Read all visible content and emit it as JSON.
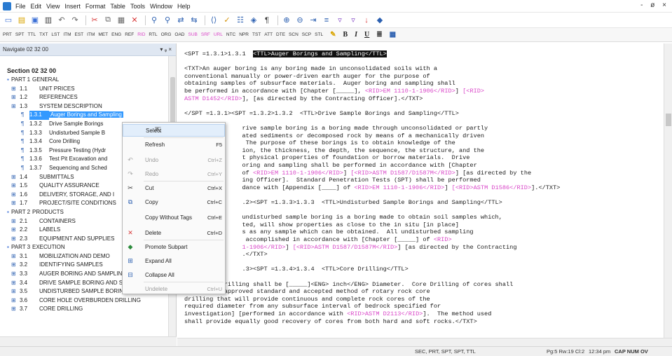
{
  "menu": [
    "File",
    "Edit",
    "View",
    "Insert",
    "Format",
    "Table",
    "Tools",
    "Window",
    "Help"
  ],
  "window_controls": "- ø ×",
  "toolbar": {
    "icons": [
      "new-document-icon",
      "open-folder-icon",
      "save-icon",
      "print-icon",
      "undo-icon",
      "redo-icon",
      "cut-icon",
      "copy-icon",
      "paste-icon",
      "delete-icon",
      "find-icon",
      "find-next-icon",
      "replace-icon",
      "replace-all-icon",
      "show-tags-icon",
      "spellcheck-icon",
      "thesaurus-icon",
      "show-hide-icon",
      "paragraph-icon",
      "zoom-in-icon",
      "zoom-out-icon",
      "indent-icon",
      "list-icon",
      "filter-icon",
      "filter-off-icon",
      "arrow-icon",
      "bookmark-icon"
    ]
  },
  "tag_toolbar": {
    "tags": [
      {
        "t": "PRT",
        "c": "n"
      },
      {
        "t": "SPT",
        "c": "n"
      },
      {
        "t": "TTL",
        "c": "n"
      },
      {
        "t": "TXT",
        "c": "n"
      },
      {
        "t": "LST",
        "c": "n"
      },
      {
        "t": "ITM",
        "c": "n"
      },
      {
        "t": "EST",
        "c": "n"
      },
      {
        "t": "ITM",
        "c": "n"
      },
      {
        "t": "MET",
        "c": "n"
      },
      {
        "t": "ENG",
        "c": "n"
      },
      {
        "t": "REF",
        "c": "n"
      },
      {
        "t": "RID",
        "c": "p"
      },
      {
        "t": "RTL",
        "c": "n"
      },
      {
        "t": "ORG",
        "c": "n"
      },
      {
        "t": "OAD",
        "c": "n"
      },
      {
        "t": "SUB",
        "c": "p"
      },
      {
        "t": "SRF",
        "c": "p"
      },
      {
        "t": "URL",
        "c": "p"
      },
      {
        "t": "NTC",
        "c": "n"
      },
      {
        "t": "NPR",
        "c": "n"
      },
      {
        "t": "TST",
        "c": "n"
      },
      {
        "t": "ATT",
        "c": "n"
      },
      {
        "t": "DTE",
        "c": "n"
      },
      {
        "t": "SCN",
        "c": "n"
      },
      {
        "t": "SCP",
        "c": "n"
      },
      {
        "t": "STL",
        "c": "n"
      }
    ],
    "format": [
      "B",
      "I",
      "U"
    ]
  },
  "navigator": {
    "title": "Navigate 02 32 00",
    "controls": "▾ ᵩ ×",
    "section": "Section 02 32 00",
    "items": [
      {
        "num": "PART 1",
        "label": "GENERAL",
        "indent": 0,
        "icon": "part"
      },
      {
        "num": "1.1",
        "label": "UNIT PRICES",
        "indent": 1
      },
      {
        "num": "1.2",
        "label": "REFERENCES",
        "indent": 1
      },
      {
        "num": "1.3",
        "label": "SYSTEM DESCRIPTION",
        "indent": 1
      },
      {
        "num": "1.3.1",
        "label": "Auger Borings and Sampling",
        "indent": 2,
        "selected": true
      },
      {
        "num": "1.3.2",
        "label": "Drive Sample Borings",
        "indent": 2
      },
      {
        "num": "1.3.3",
        "label": "Undisturbed Sample B",
        "indent": 2
      },
      {
        "num": "1.3.4",
        "label": "Core Drilling",
        "indent": 2
      },
      {
        "num": "1.3.5",
        "label": "Pressure Testing (Hydr",
        "indent": 2
      },
      {
        "num": "1.3.6",
        "label": "Test Pit Excavation and",
        "indent": 2
      },
      {
        "num": "1.3.7",
        "label": "Sequencing and Sched",
        "indent": 2
      },
      {
        "num": "1.4",
        "label": "SUBMITTALS",
        "indent": 1
      },
      {
        "num": "1.5",
        "label": "QUALITY ASSURANCE",
        "indent": 1
      },
      {
        "num": "1.6",
        "label": "DELIVERY, STORAGE, AND I",
        "indent": 1
      },
      {
        "num": "1.7",
        "label": "PROJECT/SITE CONDITIONS",
        "indent": 1
      },
      {
        "num": "PART 2",
        "label": "PRODUCTS",
        "indent": 0,
        "icon": "part"
      },
      {
        "num": "2.1",
        "label": "CONTAINERS",
        "indent": 1
      },
      {
        "num": "2.2",
        "label": "LABELS",
        "indent": 1
      },
      {
        "num": "2.3",
        "label": "EQUIPMENT AND SUPPLIES",
        "indent": 1
      },
      {
        "num": "PART 3",
        "label": "EXECUTION",
        "indent": 0,
        "icon": "part"
      },
      {
        "num": "3.1",
        "label": "MOBILIZATION AND DEMO",
        "indent": 1
      },
      {
        "num": "3.2",
        "label": "IDENTIFYING SAMPLES",
        "indent": 1
      },
      {
        "num": "3.3",
        "label": "AUGER BORING AND SAMPLING",
        "indent": 1
      },
      {
        "num": "3.4",
        "label": "DRIVE SAMPLE BORING AND SAMPLING",
        "indent": 1
      },
      {
        "num": "3.5",
        "label": "UNDISTURBED SAMPLE BORING AND SAMI",
        "indent": 1
      },
      {
        "num": "3.6",
        "label": "CORE HOLE OVERBURDEN DRILLING",
        "indent": 1
      },
      {
        "num": "3.7",
        "label": "CORE DRILLING",
        "indent": 1
      }
    ]
  },
  "editor": {
    "lines": [
      [
        {
          "t": "<SPT =1.3.1>1.3.1  "
        },
        {
          "t": "<TTL>Auger Borings and Sampling</TTL>",
          "h": 1
        }
      ],
      [
        {
          "t": ""
        }
      ],
      [
        {
          "t": "<TXT>An auger boring is any boring made in unconsolidated soils with a"
        }
      ],
      [
        {
          "t": "conventional manually or power-driven earth auger for the purpose of"
        }
      ],
      [
        {
          "t": "obtaining samples of subsurface materials.  Auger boring and sampling shall"
        }
      ],
      [
        {
          "t": "be performed in accordance with [Chapter [_____], "
        },
        {
          "t": "<RID>EM 1110-1-1906</RID>",
          "p": 1
        },
        {
          "t": "] "
        },
        {
          "t": "[<RID>",
          "p": 1
        }
      ],
      [
        {
          "t": "ASTM D1452</RID>",
          "p": 1
        },
        {
          "t": "], [as directed by the Contracting Officer].</TXT>"
        }
      ],
      [
        {
          "t": ""
        }
      ],
      [
        {
          "t": "</SPT =1.3.1><SPT =1.3.2>1.3.2  <TTL>Drive Sample Borings and Sampling</TTL>"
        }
      ],
      [
        {
          "t": ""
        }
      ],
      [
        {
          "t": "                rive sample boring is a boring made through unconsolidated or partly"
        }
      ],
      [
        {
          "t": "                ated sediments or decomposed rock by means of a mechanically driven"
        }
      ],
      [
        {
          "t": "                 The purpose of these borings is to obtain knowledge of the"
        }
      ],
      [
        {
          "t": "                ion, the thickness, the depth, the sequence, the structure, and the"
        }
      ],
      [
        {
          "t": "                t physical properties of foundation or borrow materials.  Drive"
        }
      ],
      [
        {
          "t": "                oring and sampling shall be performed in accordance with [Chapter"
        }
      ],
      [
        {
          "t": "                of "
        },
        {
          "t": "<RID>EM 1110-1-1906</RID>",
          "p": 1
        },
        {
          "t": "] "
        },
        {
          "t": "[<RID>ASTM D1587/D1587M</RID>",
          "p": 1
        },
        {
          "t": "] [as directed by the"
        }
      ],
      [
        {
          "t": "                ing Officer].  Standard Penetration Tests (SPT) shall be performed"
        }
      ],
      [
        {
          "t": "                dance with [Appendix [____] of "
        },
        {
          "t": "<RID>EM 1110-1-1906</RID>",
          "p": 1
        },
        {
          "t": "] "
        },
        {
          "t": "[<RID>ASTM D1586</RID>",
          "p": 1
        },
        {
          "t": "].</TXT>"
        }
      ],
      [
        {
          "t": ""
        }
      ],
      [
        {
          "t": "                .2><SPT =1.3.3>1.3.3  <TTL>Undisturbed Sample Borings and Sampling</TTL>"
        }
      ],
      [
        {
          "t": ""
        }
      ],
      [
        {
          "t": "                undisturbed sample boring is a boring made to obtain soil samples which,"
        }
      ],
      [
        {
          "t": "                ted, will show properties as close to the in situ [in place]"
        }
      ],
      [
        {
          "t": "                s as any sample which can be obtained.  All undisturbed sampling"
        }
      ],
      [
        {
          "t": "                 accomplished in accordance with [Chapter [_____] of "
        },
        {
          "t": "<RID>",
          "p": 1
        }
      ],
      [
        {
          "t": "                1-1906</RID>",
          "p": 1
        },
        {
          "t": "] "
        },
        {
          "t": "[<RID>ASTM D1587/D1587M</RID>",
          "p": 1
        },
        {
          "t": "] [as directed by the Contracting"
        }
      ],
      [
        {
          "t": "                .</TXT>"
        }
      ],
      [
        {
          "t": ""
        }
      ],
      [
        {
          "t": "                .3><SPT =1.3.4>1.3.4  <TTL>Core Drilling</TTL>"
        }
      ],
      [
        {
          "t": ""
        }
      ],
      [
        {
          "t": "<TXT>Core drilling shall be [_____]<ENG> inch</ENG> Diameter.  Core Drilling of cores shall"
        }
      ],
      [
        {
          "t": "be [by any approved standard and accepted method of rotary rock core"
        }
      ],
      [
        {
          "t": "drilling that will provide continuous and complete rock cores of the"
        }
      ],
      [
        {
          "t": "required diameter from any subsurface interval of bedrock specified for"
        }
      ],
      [
        {
          "t": "investigation] [performed in accordance with "
        },
        {
          "t": "<RID>ASTM D2113</RID>",
          "p": 1
        },
        {
          "t": "].  The method used"
        }
      ],
      [
        {
          "t": "shall provide equally good recovery of cores from both hard and soft rocks.</TXT>"
        }
      ]
    ]
  },
  "context_menu": {
    "items": [
      {
        "label": "Select",
        "shortcut": "",
        "icon": "",
        "hover": true
      },
      {
        "label": "Refresh",
        "shortcut": "F5",
        "icon": ""
      },
      {
        "label": "Undo",
        "shortcut": "Ctrl+Z",
        "icon": "undo-icon",
        "disabled": true
      },
      {
        "label": "Redo",
        "shortcut": "Ctrl+Y",
        "icon": "redo-icon",
        "disabled": true
      },
      {
        "label": "Cut",
        "shortcut": "Ctrl+X",
        "icon": "cut-icon"
      },
      {
        "label": "Copy",
        "shortcut": "Ctrl+C",
        "icon": "copy-icon"
      },
      {
        "label": "Copy Without Tags",
        "shortcut": "Ctrl+E",
        "icon": ""
      },
      {
        "label": "Delete",
        "shortcut": "Ctrl+D",
        "icon": "delete-icon"
      },
      {
        "label": "Promote Subpart",
        "shortcut": "",
        "icon": "promote-icon"
      },
      {
        "label": "Expand All",
        "shortcut": "",
        "icon": "expand-icon"
      },
      {
        "label": "Collapse All",
        "shortcut": "",
        "icon": "collapse-icon"
      },
      {
        "label": "Undelete",
        "shortcut": "Ctrl+U",
        "icon": "",
        "disabled": true
      }
    ]
  },
  "status": {
    "tags": "SEC, PRT, SPT, SPT, TTL",
    "position": "Pg:5 Rw:19 Cl:2",
    "time": "12:34 pm",
    "flags": "CAP NUM OV"
  }
}
